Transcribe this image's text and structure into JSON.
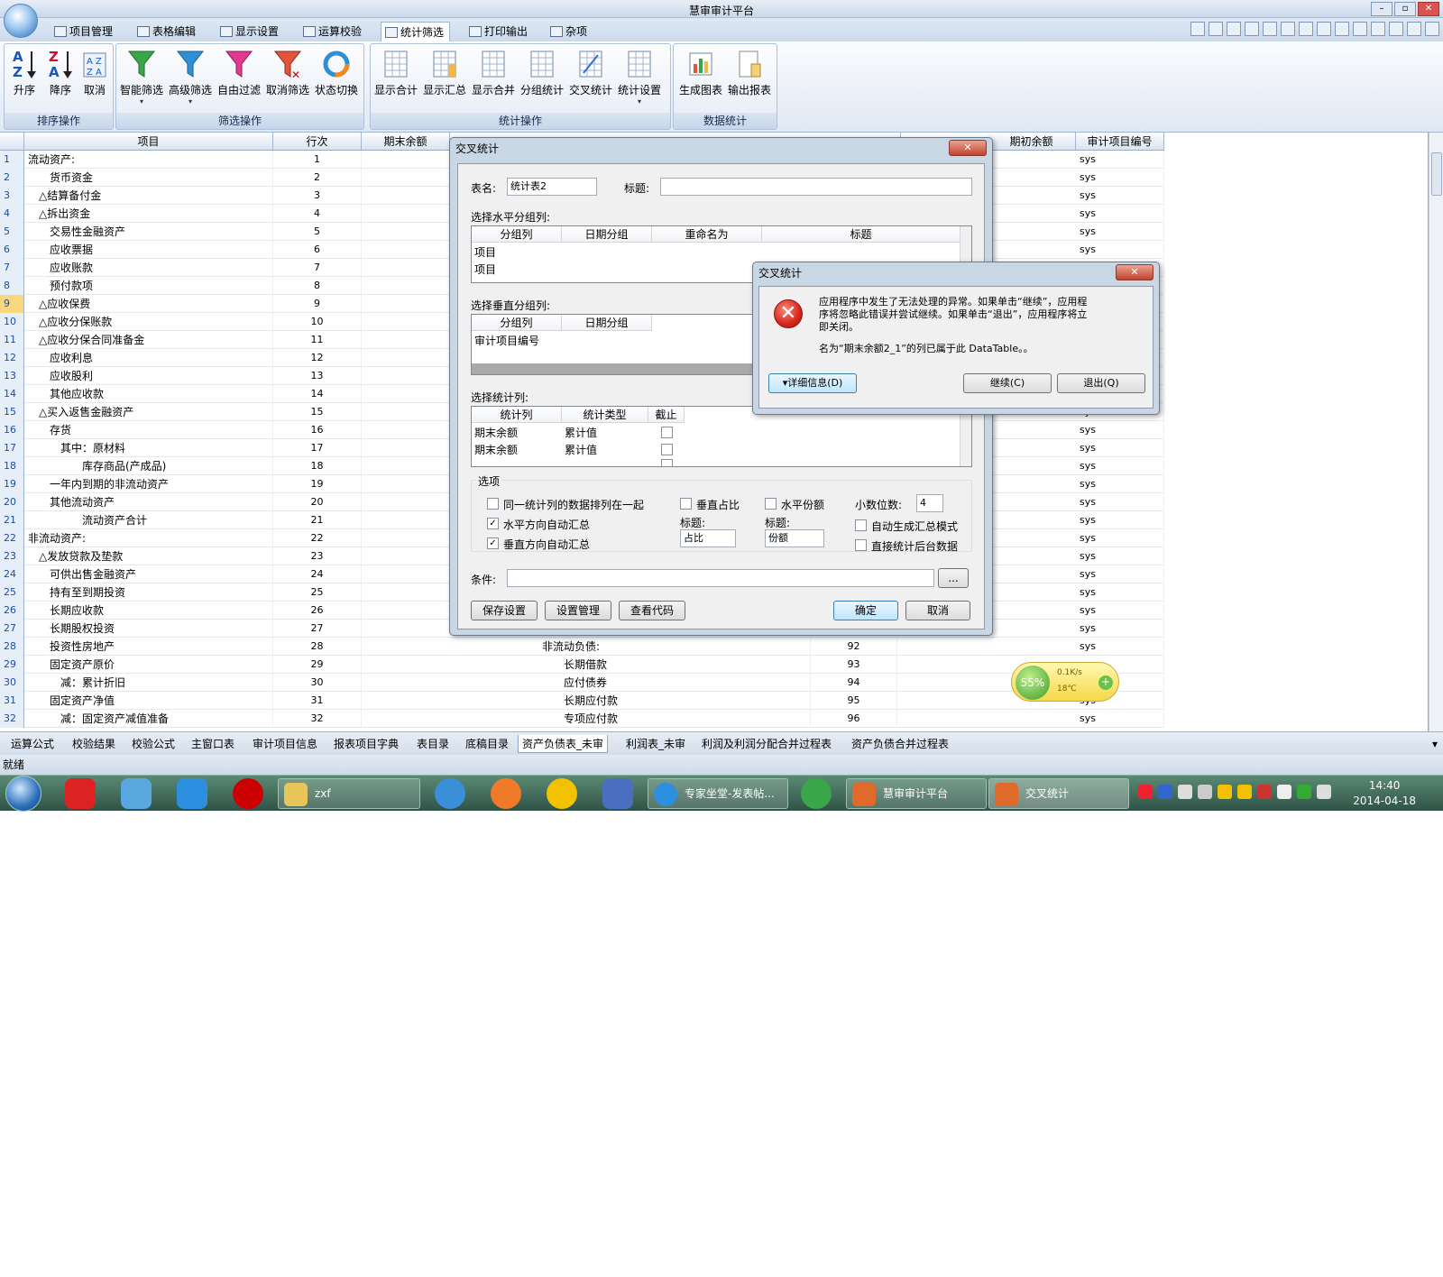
{
  "app": {
    "title": "慧审审计平台"
  },
  "menu_tabs": [
    "项目管理",
    "表格编辑",
    "显示设置",
    "运算校验",
    "统计筛选",
    "打印输出",
    "杂项"
  ],
  "ribbon": {
    "groups": [
      {
        "label": "排序操作",
        "buttons": [
          "升序",
          "降序",
          "取消"
        ]
      },
      {
        "label": "筛选操作",
        "buttons": [
          "智能筛选",
          "高级筛选",
          "自由过滤",
          "取消筛选",
          "状态切换"
        ]
      },
      {
        "label": "统计操作",
        "buttons": [
          "显示合计",
          "显示汇总",
          "显示合并",
          "分组统计",
          "交叉统计",
          "统计设置"
        ]
      },
      {
        "label": "数据统计",
        "buttons": [
          "生成图表",
          "输出报表"
        ]
      }
    ]
  },
  "grid": {
    "headers": [
      "项目",
      "行次",
      "期末余额",
      "期初余额",
      "审计项目编号"
    ],
    "highlight_rows": [
      9
    ],
    "rows": [
      {
        "n": "1",
        "item": "流动资产:",
        "no": "1",
        "indent": 0
      },
      {
        "n": "2",
        "item": "货币资金",
        "no": "2",
        "indent": 2
      },
      {
        "n": "3",
        "item": "△结算备付金",
        "no": "3",
        "indent": 1
      },
      {
        "n": "4",
        "item": "△拆出资金",
        "no": "4",
        "indent": 1
      },
      {
        "n": "5",
        "item": "交易性金融资产",
        "no": "5",
        "indent": 2
      },
      {
        "n": "6",
        "item": "应收票据",
        "no": "6",
        "indent": 2
      },
      {
        "n": "7",
        "item": "应收账款",
        "no": "7",
        "indent": 2
      },
      {
        "n": "8",
        "item": "预付款项",
        "no": "8",
        "indent": 2
      },
      {
        "n": "9",
        "item": "△应收保费",
        "no": "9",
        "indent": 1
      },
      {
        "n": "10",
        "item": "△应收分保账款",
        "no": "10",
        "indent": 1
      },
      {
        "n": "11",
        "item": "△应收分保合同准备金",
        "no": "11",
        "indent": 1
      },
      {
        "n": "12",
        "item": "应收利息",
        "no": "12",
        "indent": 2
      },
      {
        "n": "13",
        "item": "应收股利",
        "no": "13",
        "indent": 2
      },
      {
        "n": "14",
        "item": "其他应收款",
        "no": "14",
        "indent": 2
      },
      {
        "n": "15",
        "item": "△买入返售金融资产",
        "no": "15",
        "indent": 1
      },
      {
        "n": "16",
        "item": "存货",
        "no": "16",
        "indent": 2
      },
      {
        "n": "17",
        "item": "其中：原材料",
        "no": "17",
        "indent": 3
      },
      {
        "n": "18",
        "item": "库存商品(产成品)",
        "no": "18",
        "indent": 5
      },
      {
        "n": "19",
        "item": "一年内到期的非流动资产",
        "no": "19",
        "indent": 2
      },
      {
        "n": "20",
        "item": "其他流动资产",
        "no": "20",
        "indent": 2
      },
      {
        "n": "21",
        "item": "流动资产合计",
        "no": "21",
        "indent": 5
      },
      {
        "n": "22",
        "item": "非流动资产:",
        "no": "22",
        "indent": 0
      },
      {
        "n": "23",
        "item": "△发放贷款及垫款",
        "no": "23",
        "indent": 1
      },
      {
        "n": "24",
        "item": "可供出售金融资产",
        "no": "24",
        "indent": 2
      },
      {
        "n": "25",
        "item": "持有至到期投资",
        "no": "25",
        "indent": 2
      },
      {
        "n": "26",
        "item": "长期应收款",
        "no": "26",
        "indent": 2
      },
      {
        "n": "27",
        "item": "长期股权投资",
        "no": "27",
        "indent": 2
      },
      {
        "n": "28",
        "item": "投资性房地产",
        "no": "28",
        "indent": 2,
        "r_item": "非流动负债:",
        "r_no": "92",
        "r_indent": 0
      },
      {
        "n": "29",
        "item": "固定资产原价",
        "no": "29",
        "indent": 2,
        "r_item": "长期借款",
        "r_no": "93",
        "r_indent": 2
      },
      {
        "n": "30",
        "item": "减：累计折旧",
        "no": "30",
        "indent": 3,
        "r_item": "应付债券",
        "r_no": "94",
        "r_indent": 2
      },
      {
        "n": "31",
        "item": "固定资产净值",
        "no": "31",
        "indent": 2,
        "r_item": "长期应付款",
        "r_no": "95",
        "r_indent": 2
      },
      {
        "n": "32",
        "item": "减：固定资产减值准备",
        "no": "32",
        "indent": 3,
        "r_item": "专项应付款",
        "r_no": "96",
        "r_indent": 2
      }
    ],
    "sys_value": "sys"
  },
  "sheet_tabs": [
    "运算公式",
    "校验结果",
    "校验公式",
    "主窗口表",
    "审计项目信息",
    "报表项目字典",
    "表目录",
    "底稿目录",
    "资产负债表_未审",
    "利润表_未审",
    "利润及利润分配合并过程表",
    "资产负债合并过程表"
  ],
  "active_sheet_tab": 8,
  "status": "就绪",
  "cross_dialog": {
    "title": "交叉统计",
    "table_name_label": "表名:",
    "table_name_value": "统计表2",
    "caption_label": "标题:",
    "caption_value": "",
    "h_group_label": "选择水平分组列:",
    "h_group_headers": [
      "分组列",
      "日期分组",
      "重命名为",
      "标题"
    ],
    "h_group_rows": [
      "项目",
      "项目"
    ],
    "v_group_label": "选择垂直分组列:",
    "v_group_headers": [
      "分组列",
      "日期分组"
    ],
    "v_group_rows": [
      "审计项目编号"
    ],
    "stat_label": "选择统计列:",
    "stat_headers": [
      "统计列",
      "统计类型",
      "截止"
    ],
    "stat_rows": [
      {
        "col": "期末余额",
        "type": "累计值"
      },
      {
        "col": "期末余额",
        "type": "累计值"
      }
    ],
    "options_label": "选项",
    "opt_same": "同一统计列的数据排列在一起",
    "opt_h_sum": "水平方向自动汇总",
    "opt_v_sum": "垂直方向自动汇总",
    "opt_v_pct": "垂直占比",
    "opt_h_share": "水平份额",
    "title_lbl": "标题:",
    "pct_title": "占比",
    "share_title": "份额",
    "decimals_label": "小数位数:",
    "decimals_value": "4",
    "opt_auto_mode": "自动生成汇总模式",
    "opt_direct": "直接统计后台数据",
    "condition_label": "条件:",
    "browse_label": "...",
    "buttons": {
      "save": "保存设置",
      "manage": "设置管理",
      "code": "查看代码",
      "ok": "确定",
      "cancel": "取消"
    }
  },
  "error_dialog": {
    "title": "交叉统计",
    "message1": "应用程序中发生了无法处理的异常。如果单击“继续”，应用程",
    "message2": "序将忽略此错误并尝试继续。如果单击“退出”，应用程序将立",
    "message3": "即关闭。",
    "message4": "名为“期末余额2_1”的列已属于此 DataTable。。",
    "details": "详细信息(D)",
    "continue": "继续(C)",
    "quit": "退出(Q)"
  },
  "taskbar": {
    "items": [
      {
        "label": "zxf"
      },
      {
        "label": "专家坐堂-发表帖..."
      },
      {
        "label": "慧审审计平台"
      },
      {
        "label": "交叉统计"
      }
    ],
    "time": "14:40",
    "date": "2014-04-18"
  },
  "gadget": {
    "percent": "55%",
    "speed": "0.1K/s",
    "temp": "18℃"
  }
}
